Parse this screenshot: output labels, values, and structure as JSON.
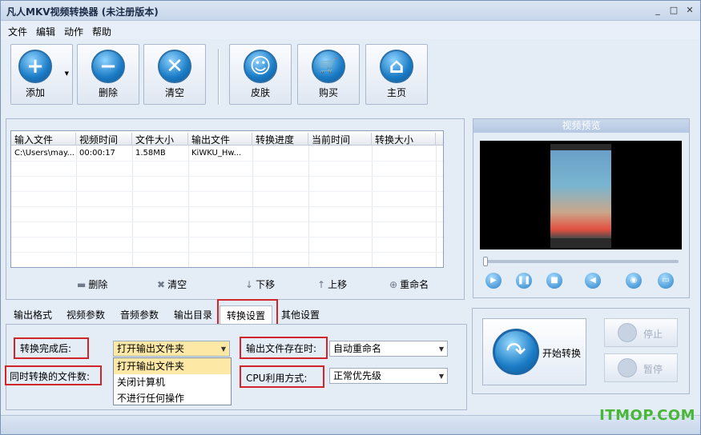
{
  "window": {
    "title": "凡人MKV视频转换器  (未注册版本)",
    "controls": [
      "_",
      "□",
      "✕"
    ]
  },
  "menu": [
    "文件",
    "编辑",
    "动作",
    "帮助"
  ],
  "toolbar": {
    "add": "添加",
    "delete": "删除",
    "clear": "清空",
    "skin": "皮肤",
    "buy": "购买",
    "home": "主页"
  },
  "table": {
    "columns": [
      "输入文件",
      "视频时间",
      "文件大小",
      "输出文件",
      "转换进度",
      "当前时间",
      "转换大小"
    ],
    "rows": [
      [
        "C:\\Users\\may...",
        "00:00:17",
        "1.58MB",
        "KiWKU_Hw...",
        "",
        "",
        ""
      ]
    ]
  },
  "list_actions": {
    "delete": "删除",
    "clear": "清空",
    "down": "下移",
    "up": "上移",
    "rename": "重命名"
  },
  "preview": {
    "title": "视频预览",
    "seek_position": 0
  },
  "tabs": [
    "输出格式",
    "视频参数",
    "音频参数",
    "输出目录",
    "转换设置",
    "其他设置"
  ],
  "active_tab": "转换设置",
  "settings": {
    "after_convert_label": "转换完成后:",
    "after_convert_value": "打开输出文件夹",
    "after_convert_options": [
      "打开输出文件夹",
      "关闭计算机",
      "不进行任何操作"
    ],
    "concurrent_label": "同时转换的文件数:",
    "output_exists_label": "输出文件存在时:",
    "output_exists_value": "自动重命名",
    "cpu_label": "CPU利用方式:",
    "cpu_value": "正常优先级"
  },
  "convert": {
    "start": "开始转换",
    "stop": "停止",
    "pause": "暂停"
  },
  "watermark": "ITMOP.COM"
}
